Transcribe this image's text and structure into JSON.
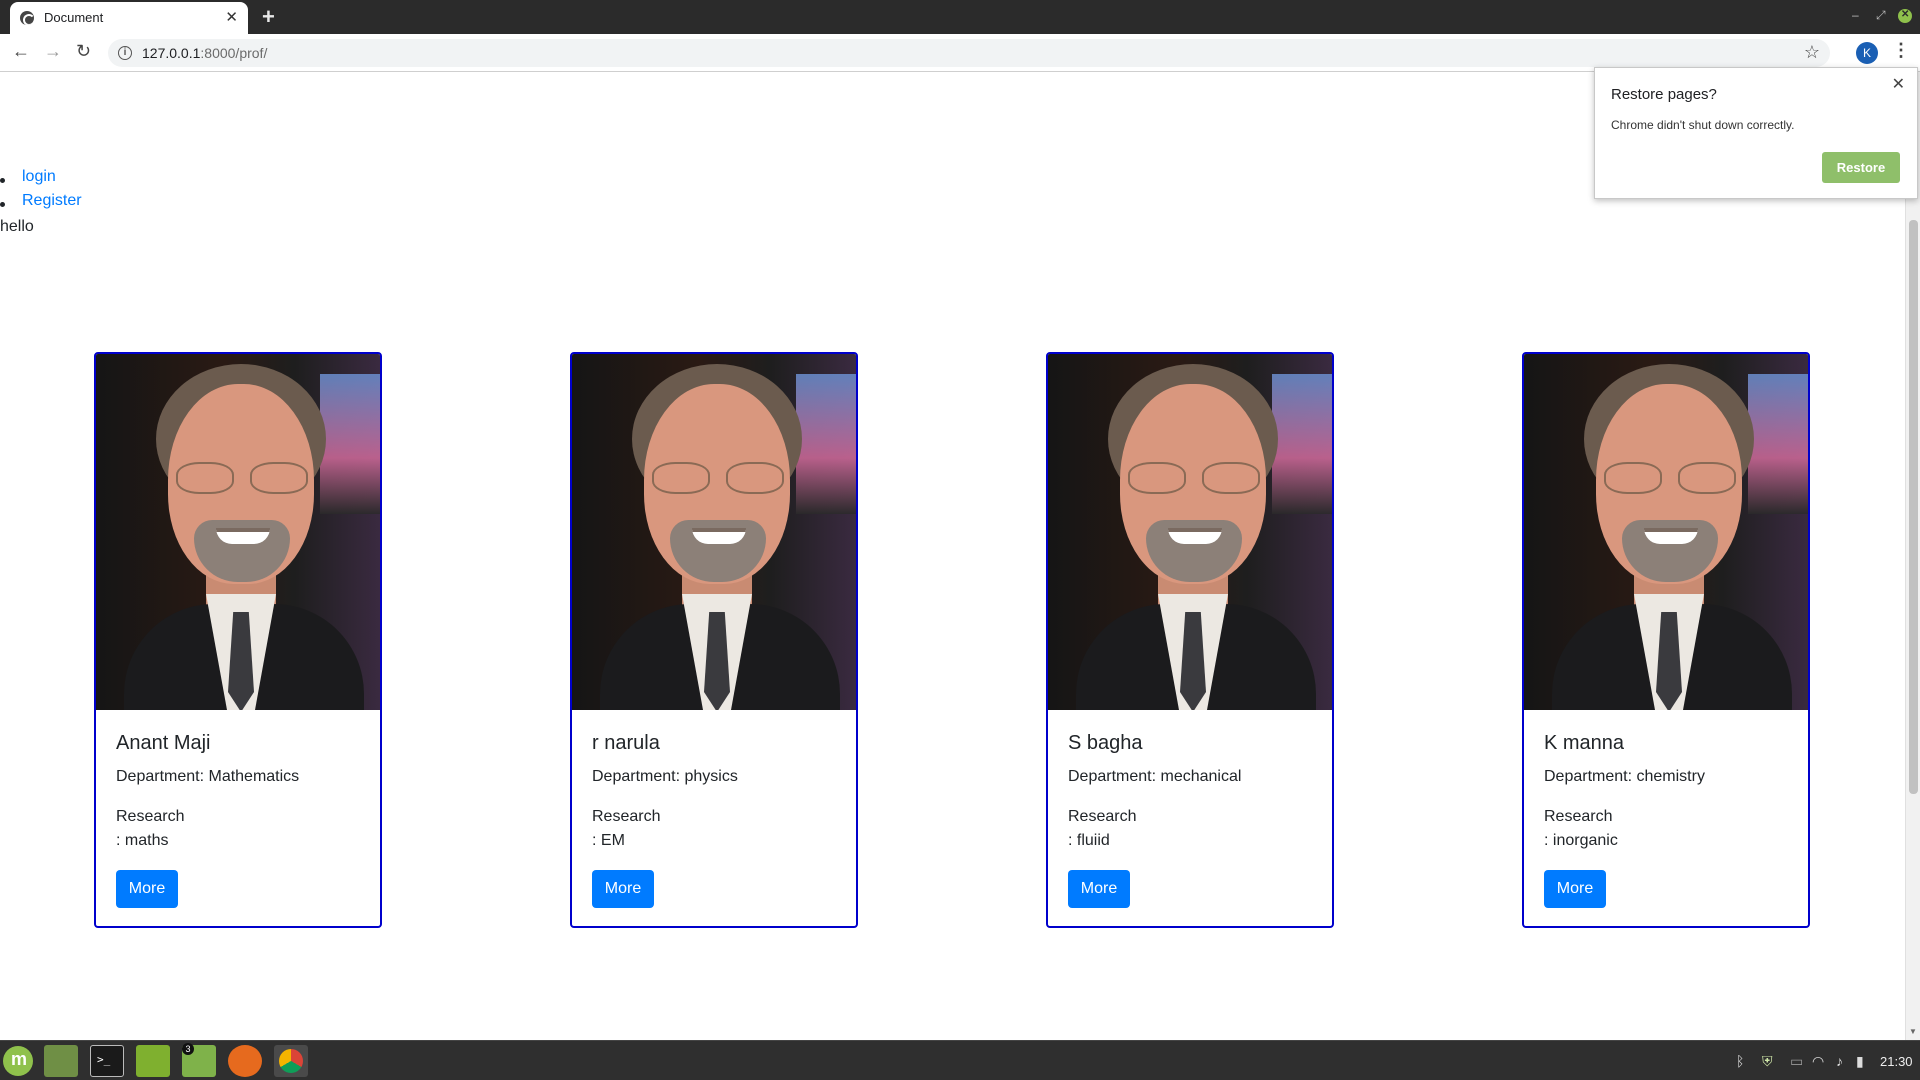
{
  "browser": {
    "tab_title": "Document",
    "url_host": "127.0.0.1",
    "url_rest": ":8000/prof/",
    "profile_initial": "K"
  },
  "page": {
    "nav": [
      {
        "label": "login"
      },
      {
        "label": "Register"
      }
    ],
    "greeting": "hello",
    "cards": [
      {
        "name": "Anant Maji",
        "department": "Department: Mathematics",
        "research_label": "Research",
        "research": ": maths",
        "button": "More"
      },
      {
        "name": "r narula",
        "department": "Department: physics",
        "research_label": "Research",
        "research": ": EM",
        "button": "More"
      },
      {
        "name": "S bagha",
        "department": "Department: mechanical",
        "research_label": "Research",
        "research": ": fluiid",
        "button": "More"
      },
      {
        "name": "K manna",
        "department": "Department: chemistry",
        "research_label": "Research",
        "research": ": inorganic",
        "button": "More"
      }
    ]
  },
  "restore_popup": {
    "title": "Restore pages?",
    "message": "Chrome didn't shut down correctly.",
    "button": "Restore"
  },
  "taskbar": {
    "files_badge": "3",
    "clock": "21:30"
  },
  "colors": {
    "link": "#007bff",
    "button": "#007bff",
    "card_border": "#0000cc",
    "restore_button": "#8fbf6a"
  },
  "icons": [
    "back-arrow-icon",
    "forward-arrow-icon",
    "reload-icon",
    "info-icon",
    "star-icon",
    "menu-dots-icon",
    "close-icon",
    "new-tab-icon"
  ]
}
